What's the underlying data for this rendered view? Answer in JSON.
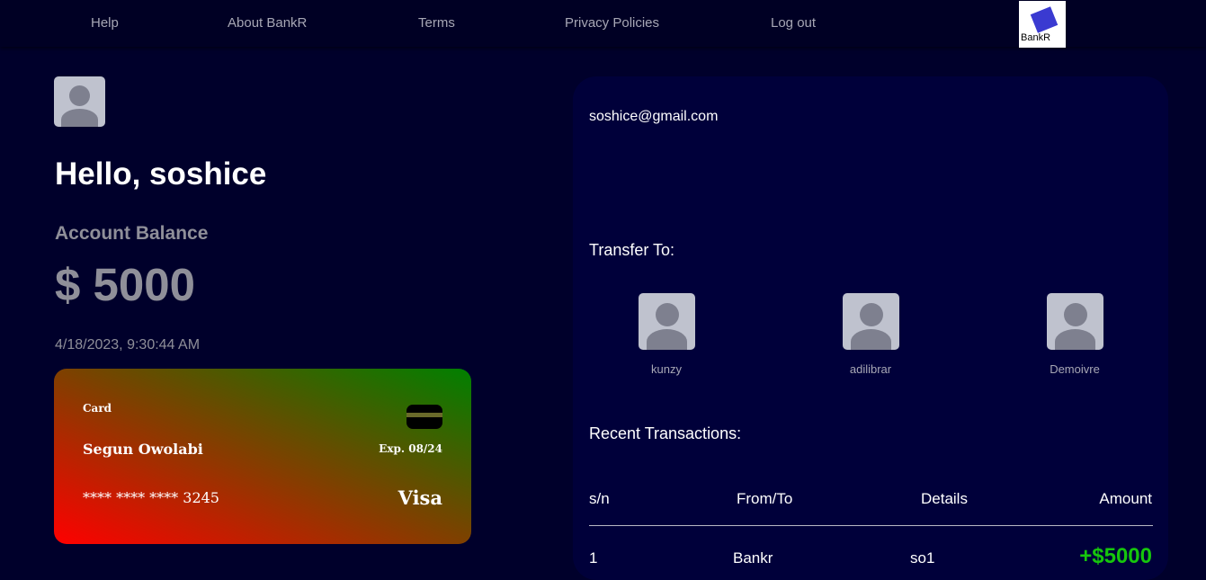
{
  "nav": {
    "items": [
      "Help",
      "About BankR",
      "Terms",
      "Privacy Policies",
      "Log out"
    ],
    "logo_text": "BankR"
  },
  "profile": {
    "greeting": "Hello, soshice",
    "balance_label": "Account Balance",
    "balance_value": "$ 5000",
    "datetime": "4/18/2023, 9:30:44 AM",
    "email": "soshice@gmail.com"
  },
  "card": {
    "label": "Card",
    "holder": "Segun Owolabi",
    "expiry": "Exp. 08/24",
    "number": "**** **** **** 3245",
    "brand": "Visa",
    "gradient_colors": [
      "#ff0000",
      "#8b3a00",
      "#008000"
    ]
  },
  "transfer": {
    "title": "Transfer To:",
    "contacts": [
      "kunzy",
      "adilibrar",
      "Demoivre"
    ]
  },
  "transactions": {
    "title": "Recent Transactions:",
    "columns": [
      "s/n",
      "From/To",
      "Details",
      "Amount"
    ],
    "rows": [
      {
        "sn": "1",
        "party": "Bankr",
        "details": "so1",
        "amount": "+$5000"
      }
    ],
    "positive_color": "#16c60c"
  }
}
